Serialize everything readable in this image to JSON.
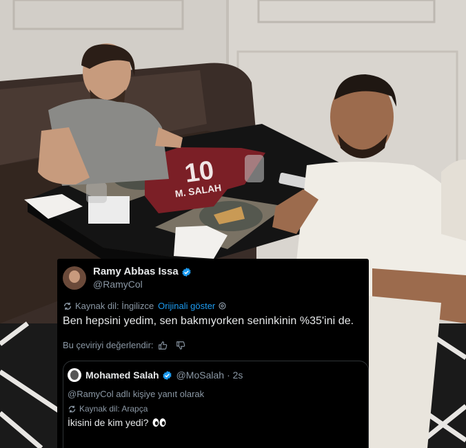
{
  "tweet": {
    "author_name": "Ramy Abbas Issa",
    "author_handle": "@RamyCol",
    "source_language": "Kaynak dil: İngilizce",
    "show_original": "Orijinali göster",
    "text": "Ben hepsini yedim, sen bakmıyorken seninkinin %35'ini de.",
    "rate_translation": "Bu çeviriyi değerlendir:"
  },
  "quoted_tweet": {
    "author_name": "Mohamed Salah",
    "author_handle": "@MoSalah",
    "time": "· 2s",
    "reply_to": "@RamyCol adlı kişiye yanıt olarak",
    "source_language": "Kaynak dil: Arapça",
    "text": "İkisini de kim yedi?",
    "emoji": "eyes"
  },
  "photo": {
    "jersey_number": "10",
    "jersey_name": "M. SALAH"
  },
  "colors": {
    "verified": "#1d9bf0",
    "card_bg": "#000000",
    "link": "#1d9bf0"
  }
}
